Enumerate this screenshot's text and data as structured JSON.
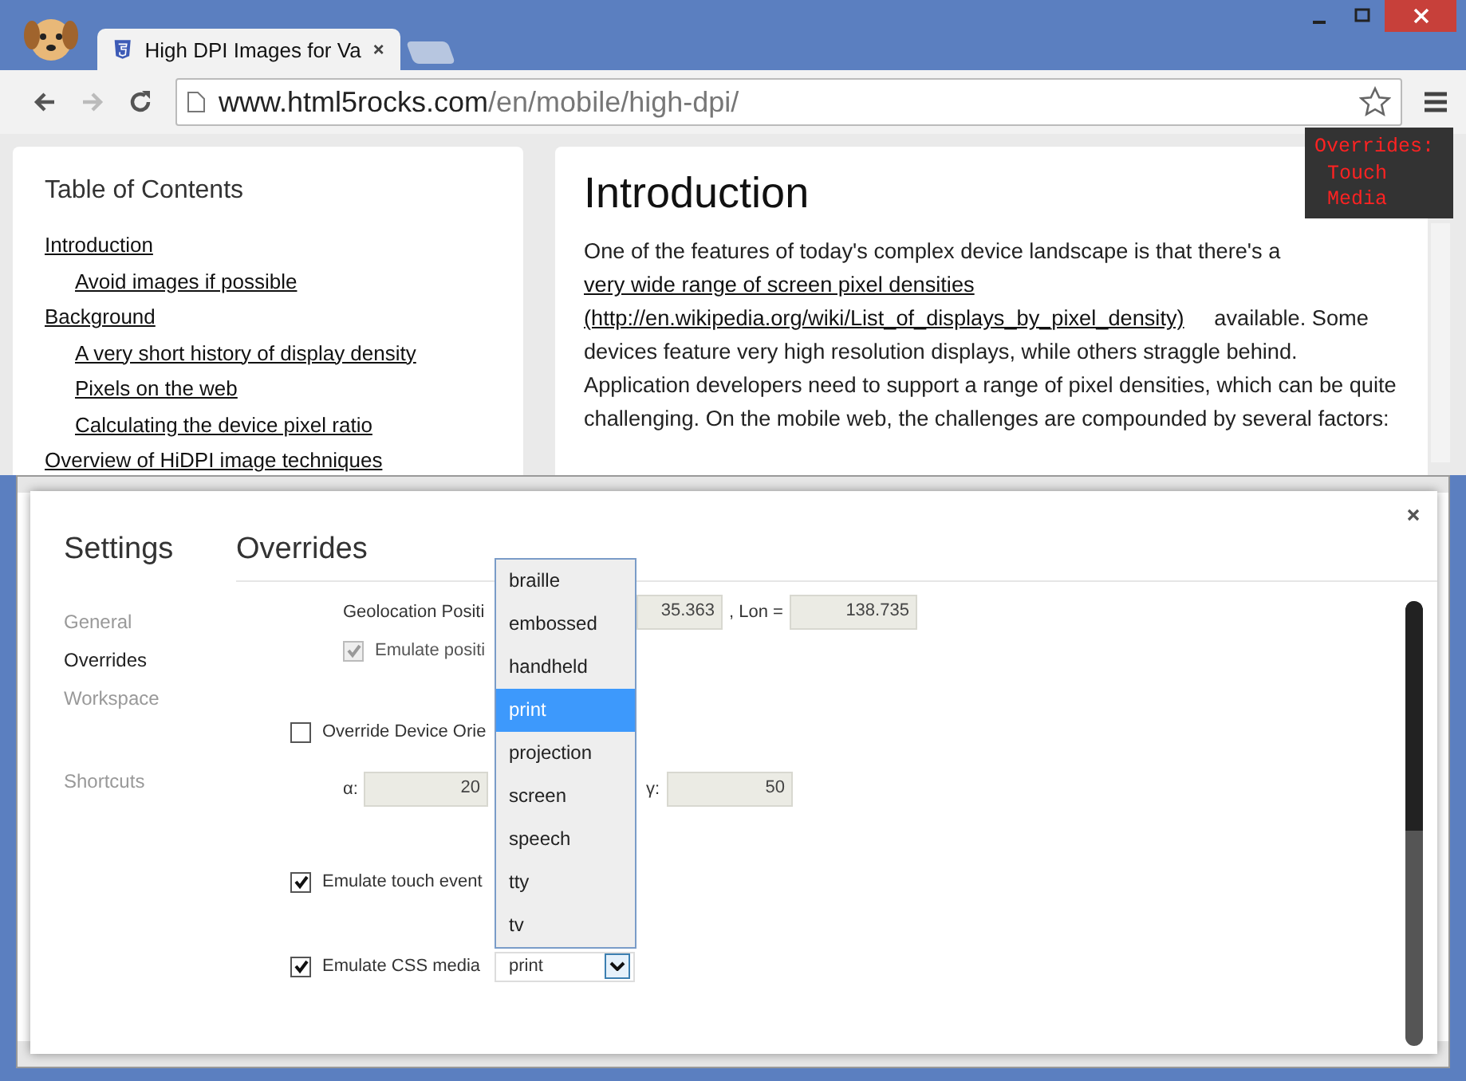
{
  "browser": {
    "tab_title": "High DPI Images for Va",
    "url_host": "www.html5rocks.com",
    "url_path": "/en/mobile/high-dpi/",
    "forward_disabled": true
  },
  "toc": {
    "title": "Table of Contents",
    "items": [
      {
        "label": "Introduction",
        "children": [
          {
            "label": "Avoid images if possible"
          }
        ]
      },
      {
        "label": "Background",
        "children": [
          {
            "label": "A very short history of display density"
          },
          {
            "label": "Pixels on the web"
          },
          {
            "label": "Calculating the device pixel ratio"
          }
        ]
      },
      {
        "label": "Overview of HiDPI image techniques"
      }
    ]
  },
  "article": {
    "heading": "Introduction",
    "text_before": "One of the features of today's complex device landscape is that there's a",
    "link": "very wide range of screen pixel densities",
    "link_url": "(http://en.wikipedia.org/wiki/List_of_displays_by_pixel_density)",
    "text_after": "available. Some devices feature very high resolution displays, while others straggle behind. Application developers need to support a range of pixel densities, which can be quite challenging. On the mobile web, the challenges are compounded by several factors:"
  },
  "override_badge": [
    "Overrides:",
    "Touch",
    "Media"
  ],
  "settings": {
    "title": "Settings",
    "heading": "Overrides",
    "nav_groups": [
      [
        {
          "label": "General",
          "selected": false
        },
        {
          "label": "Overrides",
          "selected": true
        },
        {
          "label": "Workspace",
          "selected": false
        }
      ],
      [
        {
          "label": "Shortcuts",
          "selected": false
        }
      ]
    ],
    "geolocation": {
      "label": "Geolocation Positi",
      "lat": "35.363",
      "lon_label": ", Lon =",
      "lon": "138.735"
    },
    "emulate_position": {
      "label": "Emulate positi",
      "checked": true,
      "disabled": true
    },
    "device_orientation": {
      "label": "Override Device Orie",
      "checked": false
    },
    "alpha": {
      "label": "α:",
      "value": "20"
    },
    "gamma": {
      "label": "γ:",
      "value": "50"
    },
    "touch": {
      "label": "Emulate touch event",
      "checked": true
    },
    "css_media": {
      "label": "Emulate CSS media",
      "checked": true,
      "value": "print",
      "options": [
        {
          "label": "braille",
          "selected": false
        },
        {
          "label": "embossed",
          "selected": false
        },
        {
          "label": "handheld",
          "selected": false
        },
        {
          "label": "print",
          "selected": true
        },
        {
          "label": "projection",
          "selected": false
        },
        {
          "label": "screen",
          "selected": false
        },
        {
          "label": "speech",
          "selected": false
        },
        {
          "label": "tty",
          "selected": false
        },
        {
          "label": "tv",
          "selected": false
        }
      ]
    }
  }
}
